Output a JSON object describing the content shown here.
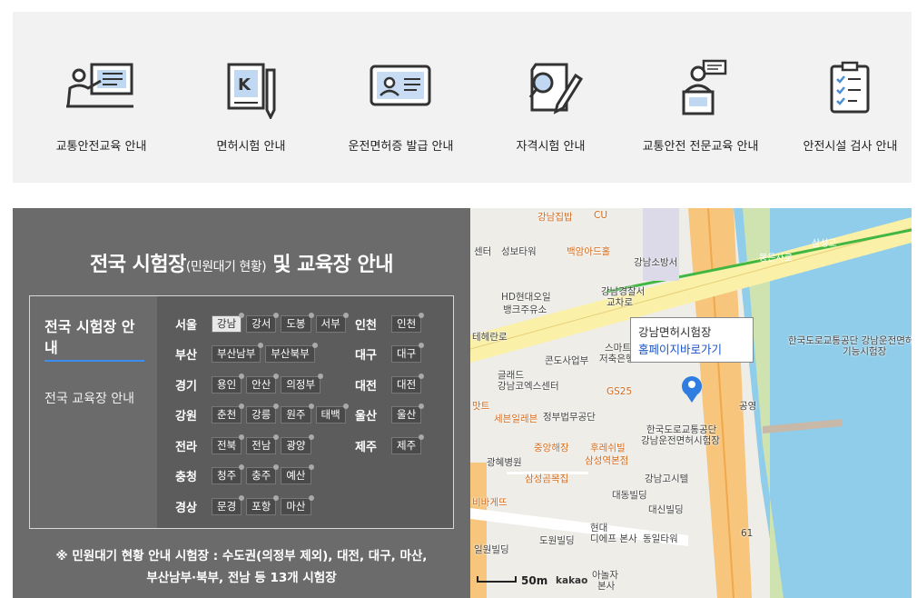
{
  "services": [
    {
      "label": "교통안전교육 안내",
      "icon": "presentation-icon"
    },
    {
      "label": "면허시험 안내",
      "icon": "license-pencil-icon"
    },
    {
      "label": "운전면허증 발급 안내",
      "icon": "id-card-icon"
    },
    {
      "label": "자격시험 안내",
      "icon": "exam-search-icon"
    },
    {
      "label": "교통안전 전문교육 안내",
      "icon": "lecturer-podium-icon"
    },
    {
      "label": "안전시설 검사 안내",
      "icon": "clipboard-check-icon"
    }
  ],
  "panel": {
    "title_a": "전국 시험장",
    "title_b": "(민원대기 현황)",
    "title_c": " 및 교육장 안내",
    "tab_test": "전국 시험장 안내",
    "tab_edu": "전국 교육장 안내",
    "regions_left": [
      {
        "name": "서울",
        "sites": [
          "강남",
          "강서",
          "도봉",
          "서부"
        ]
      },
      {
        "name": "부산",
        "sites": [
          "부산남부",
          "부산북부"
        ]
      },
      {
        "name": "경기",
        "sites": [
          "용인",
          "안산",
          "의정부"
        ]
      },
      {
        "name": "강원",
        "sites": [
          "춘천",
          "강릉",
          "원주",
          "태백"
        ]
      },
      {
        "name": "전라",
        "sites": [
          "전북",
          "전남",
          "광양"
        ]
      },
      {
        "name": "충청",
        "sites": [
          "청주",
          "충주",
          "예산"
        ]
      },
      {
        "name": "경상",
        "sites": [
          "문경",
          "포항",
          "마산"
        ]
      }
    ],
    "regions_right": [
      {
        "name": "인천",
        "sites": [
          "인천"
        ]
      },
      {
        "name": "대구",
        "sites": [
          "대구"
        ]
      },
      {
        "name": "대전",
        "sites": [
          "대전"
        ]
      },
      {
        "name": "울산",
        "sites": [
          "울산"
        ]
      },
      {
        "name": "제주",
        "sites": [
          "제주"
        ]
      }
    ],
    "note_line1": "※ 민원대기 현황 안내 시험장 : 수도권(의정부 제외), 대전, 대구, 마산,",
    "note_line2": "부산남부·북부, 전남 등 13개 시험장"
  },
  "map": {
    "popup_title": "강남면허시험장",
    "popup_link": "홈페이지바로가기",
    "scale": "50m",
    "provider": "kakao",
    "labels": {
      "l1": "강남집밥",
      "l2": "CU",
      "l3": "백암아드홀",
      "l4": "성보타워",
      "l5": "센터",
      "l6": "강남소방서",
      "l7": "HD현대오일",
      "l8": "뱅크주유소",
      "l9": "강남경찰서",
      "l10": "교차로",
      "l11": "콘도사업부",
      "l12": "스마트",
      "l13": "저축은행",
      "l14": "글래드",
      "l15": "강남코엑스센터",
      "l16": "GS25",
      "l17": "정부법무공단",
      "l18": "세븐일레븐",
      "l19": "중앙해장",
      "l20": "후레쉬빌",
      "l21": "삼성역본점",
      "l22": "광혜병원",
      "l23": "삼성곰목집",
      "l24": "강남고시텔",
      "l25": "대동빌딩",
      "l26": "대신빌딩",
      "l27": "현대",
      "l28": "도원빌딩",
      "l29": "디에프 본사",
      "l30": "동일타워",
      "l31": "일원빌딩",
      "l32": "아놀자",
      "l33": "본사",
      "l34": "한국도로교통공단",
      "l35": "강남운전면허시험장",
      "l36": "공영",
      "l37": "한국도로교통공단 강남운전면허",
      "l38": "기능시험장",
      "l39": "삼성교",
      "l40": "봉은사로",
      "l41": "테헤란로",
      "l42": "맛트",
      "l43": "비바게뜨",
      "l44": "61"
    }
  }
}
